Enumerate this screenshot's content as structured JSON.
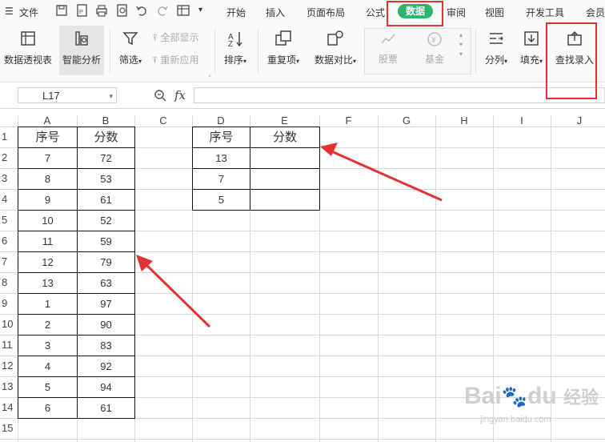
{
  "menubar": {
    "file": "文件",
    "tabs": [
      "开始",
      "插入",
      "页面布局",
      "公式",
      "数据",
      "审阅",
      "视图",
      "开发工具",
      "会员"
    ],
    "active_tab": "数据"
  },
  "ribbon": {
    "pivot": "数据透视表",
    "smart_analysis": "智能分析",
    "filter": "筛选",
    "show_all": "全部显示",
    "reapply": "重新应用",
    "sort": "排序",
    "duplicates": "重复项",
    "compare": "数据对比",
    "stock": "股票",
    "fund": "基金",
    "split": "分列",
    "fill": "填充",
    "lookup": "查找录入"
  },
  "formula_bar": {
    "name_box": "L17",
    "fx": "fx",
    "value": ""
  },
  "sheet": {
    "columns": [
      "A",
      "B",
      "C",
      "D",
      "E",
      "F",
      "G",
      "H",
      "I",
      "J"
    ],
    "rows": [
      "1",
      "2",
      "3",
      "4",
      "5",
      "6",
      "7",
      "8",
      "9",
      "10",
      "11",
      "12",
      "13",
      "14",
      "15"
    ],
    "table1": {
      "headers": [
        "序号",
        "分数"
      ],
      "rows": [
        [
          "7",
          "72"
        ],
        [
          "8",
          "53"
        ],
        [
          "9",
          "61"
        ],
        [
          "10",
          "52"
        ],
        [
          "11",
          "59"
        ],
        [
          "12",
          "79"
        ],
        [
          "13",
          "63"
        ],
        [
          "1",
          "97"
        ],
        [
          "2",
          "90"
        ],
        [
          "3",
          "83"
        ],
        [
          "4",
          "92"
        ],
        [
          "5",
          "94"
        ],
        [
          "6",
          "61"
        ]
      ]
    },
    "table2": {
      "headers": [
        "序号",
        "分数"
      ],
      "rows": [
        [
          "13",
          ""
        ],
        [
          "7",
          ""
        ],
        [
          "5",
          ""
        ]
      ]
    }
  },
  "watermark": {
    "brand": "Bai",
    "brand2": "du",
    "cn": "经验",
    "url": "jingyan.baidu.com"
  },
  "colors": {
    "accent": "#2db36e",
    "annotation": "#e43131"
  }
}
